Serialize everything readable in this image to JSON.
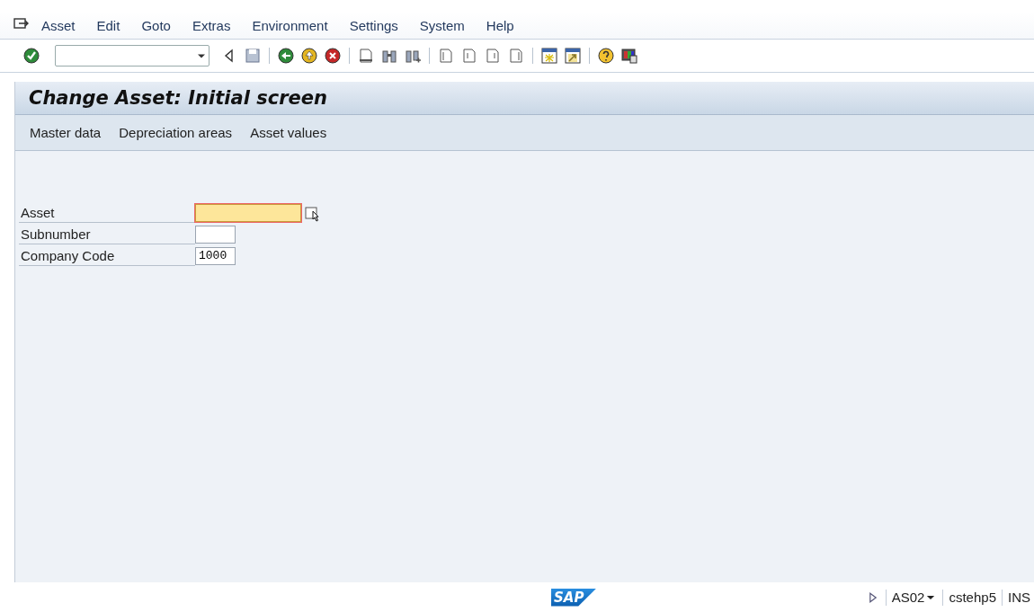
{
  "menu": [
    "Asset",
    "Edit",
    "Goto",
    "Extras",
    "Environment",
    "Settings",
    "System",
    "Help"
  ],
  "screen": {
    "title": "Change Asset: Initial screen",
    "application_toolbar": [
      "Master data",
      "Depreciation areas",
      "Asset values"
    ],
    "fields": [
      {
        "label": "Asset",
        "selected": true
      },
      {
        "label": "Subnumber",
        "selected": false
      },
      {
        "label": "Company Code",
        "value": "1000",
        "selected": false
      }
    ]
  },
  "status_bar": {
    "logo": "SAP",
    "transaction": "AS02",
    "server": "cstehp5",
    "mode": "INS"
  }
}
